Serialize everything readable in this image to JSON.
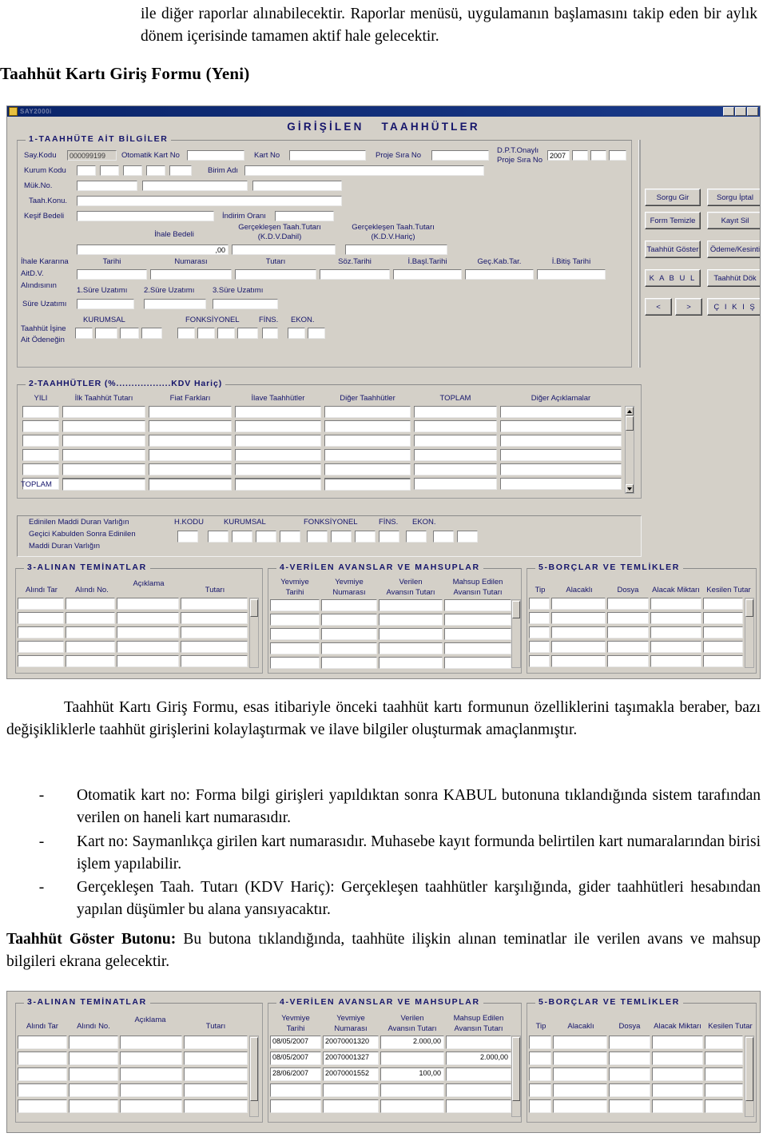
{
  "document": {
    "intro_paragraph": "ile diğer raporlar alınabilecektir. Raporlar menüsü, uygulamanın başlamasını takip eden bir aylık  dönem içerisinde tamamen aktif hale gelecektir.",
    "section_heading": "Taahhüt Kartı Giriş Formu (Yeni)",
    "paragraph_after_form": "Taahhüt Kartı Giriş Formu, esas itibariyle önceki taahhüt kartı formunun özelliklerini taşımakla beraber, bazı değişikliklerle taahhüt girişlerini kolaylaştırmak ve ilave bilgiler oluşturmak amaçlanmıştır.",
    "bullets": [
      {
        "dash": "-",
        "text": "Otomatik kart no: Forma bilgi girişleri yapıldıktan sonra KABUL butonuna tıklandığında sistem tarafından verilen on haneli kart numarasıdır."
      },
      {
        "dash": "-",
        "text": "Kart no: Saymanlıkça girilen kart numarasıdır. Muhasebe kayıt formunda belirtilen kart numaralarından birisi işlem yapılabilir."
      },
      {
        "dash": "-",
        "text": "Gerçekleşen Taah. Tutarı (KDV Hariç): Gerçekleşen taahhütler karşılığında, gider taahhütleri hesabından yapılan düşümler bu alana yansıyacaktır."
      }
    ],
    "closing_bold": "Taahhüt Göster Butonu:",
    "closing_text": " Bu butona tıklandığında, taahhüte ilişkin alınan teminatlar ile verilen avans ve mahsup bilgileri ekrana gelecektir."
  },
  "form": {
    "window_title": "SAY2000i",
    "header_left": "GİRİŞİLEN",
    "header_right": "TAAHHÜTLER",
    "section1": {
      "legend": "1-TAAHHÜTE AİT BİLGİLER",
      "say_kodu_label": "Say.Kodu",
      "say_kodu_value": "000099199",
      "otomatik_kart_no_label": "Otomatik Kart No",
      "otomatik_kart_no_value": "",
      "kart_no_label": "Kart No",
      "kart_no_value": "",
      "proje_sira_no_label": "Proje Sıra No",
      "proje_sira_no_value": "",
      "dpt_label_line1": "D.P.T.Onaylı",
      "dpt_label_line2": "Proje Sıra No",
      "dpt_year": "2007",
      "kurum_kodu_label": "Kurum Kodu",
      "birim_adi_label": "Birim Adı",
      "muk_no_label": "Mük.No.",
      "taah_konu_label": "Taah.Konu.",
      "kesif_bedeli_label": "Keşif Bedeli",
      "indirim_orani_label": "İndirim Oranı",
      "ihale_bedeli_label": "İhale Bedeli",
      "ihale_bedeli_value": ",00",
      "gerceklesen_dahil_l1": "Gerçekleşen Taah.Tutarı",
      "gerceklesen_dahil_l2": "(K.D.V.Dahil)",
      "gerceklesen_haric_l1": "Gerçekleşen Taah.Tutarı",
      "gerceklesen_haric_l2": "(K.D.V.Hariç)",
      "ihale_kararina_l1": "İhale Kararına",
      "ihale_kararina_l2": "AitD.V.",
      "ihale_kararina_l3": "Alındısının",
      "tarihi_label": "Tarihi",
      "numarasi_label": "Numarası",
      "tutari_label": "Tutarı",
      "soz_tarihi_label": "Söz.Tarihi",
      "ibasl_tarihi_label": "İ.Başl.Tarihi",
      "gec_kab_tar_label": "Geç.Kab.Tar.",
      "ibitis_tarihi_label": "İ.Bitiş Tarihi",
      "sure_uzatimi_label": "Süre Uzatımı",
      "sure_uzatimi_1": "1.Süre Uzatımı",
      "sure_uzatimi_2": "2.Süre Uzatımı",
      "sure_uzatimi_3": "3.Süre Uzatımı",
      "taahhut_isine_l1": "Taahhüt İşine",
      "taahhut_isine_l2": "Ait Ödeneğin",
      "kurumsal_label": "KURUMSAL",
      "fonksiyonel_label": "FONKSİYONEL",
      "fins_label": "FİNS.",
      "ekon_label": "EKON."
    },
    "buttons": [
      {
        "name": "sorgu-gir",
        "label": "Sorgu Gir"
      },
      {
        "name": "sorgu-iptal",
        "label": "Sorgu İptal"
      },
      {
        "name": "form-temizle",
        "label": "Form Temizle"
      },
      {
        "name": "kayit-sil",
        "label": "Kayıt Sil"
      },
      {
        "name": "taahhut-goster",
        "label": "Taahhüt Göster"
      },
      {
        "name": "odeme-kesinti",
        "label": "Ödeme/Kesinti"
      },
      {
        "name": "kabul",
        "label": "K A B U L"
      },
      {
        "name": "taahhut-dok",
        "label": "Taahhüt Dök"
      },
      {
        "name": "prev",
        "label": "<"
      },
      {
        "name": "next",
        "label": ">"
      },
      {
        "name": "cikis",
        "label": "Ç I K I Ş"
      }
    ],
    "section2": {
      "legend": "2-TAAHHÜTLER (%..................KDV Hariç)",
      "columns": [
        "YILI",
        "İlk Taahhüt Tutarı",
        "Fiat Farkları",
        "İlave Taahhütler",
        "Diğer Taahhütler",
        "TOPLAM",
        "Diğer Açıklamalar"
      ],
      "rows": [
        [
          "",
          "",
          "",
          "",
          "",
          "",
          ""
        ],
        [
          "",
          "",
          "",
          "",
          "",
          "",
          ""
        ],
        [
          "",
          "",
          "",
          "",
          "",
          "",
          ""
        ],
        [
          "",
          "",
          "",
          "",
          "",
          "",
          ""
        ],
        [
          "",
          "",
          "",
          "",
          "",
          "",
          ""
        ],
        [
          "",
          "",
          "",
          "",
          "",
          "",
          ""
        ]
      ],
      "total_label": "TOPLAM",
      "total_values": [
        "",
        "",
        "",
        ""
      ]
    },
    "mdv": {
      "line1": "Edinilen Maddi Duran Varlığın",
      "line2": "Geçici Kabulden Sonra Edinilen",
      "line3": "Maddi Duran Varlığın",
      "hkodu_label": "H.KODU",
      "kurumsal_label": "KURUMSAL",
      "fonksiyonel_label": "FONKSİYONEL",
      "fins_label": "FİNS.",
      "ekon_label": "EKON."
    },
    "section3": {
      "legend": "3-ALINAN TEMİNATLAR",
      "columns": [
        "Alındı Tar",
        "Alındı No.",
        "Açıklama",
        "Tutarı"
      ],
      "rows": [
        [
          "",
          "",
          "",
          ""
        ],
        [
          "",
          "",
          "",
          ""
        ],
        [
          "",
          "",
          "",
          ""
        ],
        [
          "",
          "",
          "",
          ""
        ],
        [
          "",
          "",
          "",
          ""
        ]
      ]
    },
    "section4": {
      "legend": "4-VERİLEN AVANSLAR VE MAHSUPLAR",
      "columns_l1": [
        "Yevmiye",
        "Yevmiye",
        "Verilen",
        "Mahsup Edilen"
      ],
      "columns_l2": [
        "Tarihi",
        "Numarası",
        "Avansın Tutarı",
        "Avansın Tutarı"
      ],
      "rows": [
        [
          "",
          "",
          "",
          ""
        ],
        [
          "",
          "",
          "",
          ""
        ],
        [
          "",
          "",
          "",
          ""
        ],
        [
          "",
          "",
          "",
          ""
        ],
        [
          "",
          "",
          "",
          ""
        ]
      ]
    },
    "section5": {
      "legend": "5-BORÇLAR VE TEMLİKLER",
      "columns": [
        "Tip",
        "Alacaklı",
        "Dosya",
        "Alacak Miktarı",
        "Kesilen Tutar"
      ],
      "rows": [
        [
          "",
          "",
          "",
          "",
          ""
        ],
        [
          "",
          "",
          "",
          "",
          ""
        ],
        [
          "",
          "",
          "",
          "",
          ""
        ],
        [
          "",
          "",
          "",
          "",
          ""
        ],
        [
          "",
          "",
          "",
          "",
          ""
        ]
      ]
    }
  },
  "form_bottom": {
    "section3": {
      "legend": "3-ALINAN TEMİNATLAR",
      "columns": [
        "Alındı Tar",
        "Alındı No.",
        "Açıklama",
        "Tutarı"
      ],
      "rows": [
        [
          "",
          "",
          "",
          ""
        ],
        [
          "",
          "",
          "",
          ""
        ],
        [
          "",
          "",
          "",
          ""
        ],
        [
          "",
          "",
          "",
          ""
        ],
        [
          "",
          "",
          "",
          ""
        ]
      ]
    },
    "section4": {
      "legend": "4-VERİLEN AVANSLAR VE MAHSUPLAR",
      "columns_l1": [
        "Yevmiye",
        "Yevmiye",
        "Verilen",
        "Mahsup Edilen"
      ],
      "columns_l2": [
        "Tarihi",
        "Numarası",
        "Avansın Tutarı",
        "Avansın Tutarı"
      ],
      "rows": [
        [
          "08/05/2007",
          "20070001320",
          "2.000,00",
          ""
        ],
        [
          "08/05/2007",
          "20070001327",
          "",
          "2.000,00"
        ],
        [
          "28/06/2007",
          "20070001552",
          "100,00",
          ""
        ],
        [
          "",
          "",
          "",
          ""
        ],
        [
          "",
          "",
          "",
          ""
        ]
      ]
    },
    "section5": {
      "legend": "5-BORÇLAR VE TEMLİKLER",
      "columns": [
        "Tip",
        "Alacaklı",
        "Dosya",
        "Alacak Miktarı",
        "Kesilen Tutar"
      ],
      "rows": [
        [
          "",
          "",
          "",
          "",
          ""
        ],
        [
          "",
          "",
          "",
          "",
          ""
        ],
        [
          "",
          "",
          "",
          "",
          ""
        ],
        [
          "",
          "",
          "",
          "",
          ""
        ],
        [
          "",
          "",
          "",
          "",
          ""
        ]
      ]
    }
  }
}
